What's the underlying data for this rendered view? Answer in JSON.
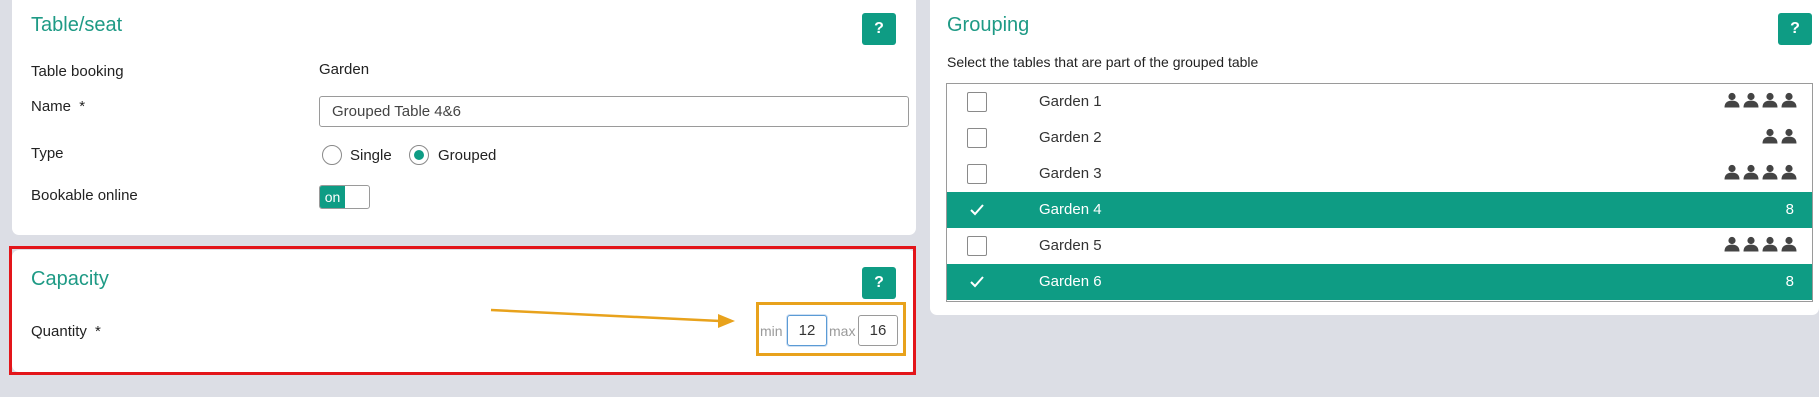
{
  "table_seat_card": {
    "title": "Table/seat",
    "help_label": "?",
    "table_booking_label": "Table booking",
    "table_booking_value": "Garden",
    "name_label": "Name",
    "required_marker": "*",
    "name_value": "Grouped Table 4&6",
    "type_label": "Type",
    "type_options": [
      "Single",
      "Grouped"
    ],
    "type_selected": "Grouped",
    "bookable_label": "Bookable online",
    "bookable_toggle": "on"
  },
  "capacity_card": {
    "title": "Capacity",
    "help_label": "?",
    "quantity_label": "Quantity",
    "required_marker": "*",
    "min_label": "min",
    "min_value": "12",
    "max_label": "max",
    "max_value": "16"
  },
  "grouping_card": {
    "title": "Grouping",
    "help_label": "?",
    "instruction": "Select the tables that are part of the grouped table",
    "tables": [
      {
        "name": "Garden 1",
        "selected": false,
        "capacity_icons": 4,
        "count": ""
      },
      {
        "name": "Garden 2",
        "selected": false,
        "capacity_icons": 2,
        "count": ""
      },
      {
        "name": "Garden 3",
        "selected": false,
        "capacity_icons": 4,
        "count": ""
      },
      {
        "name": "Garden 4",
        "selected": true,
        "capacity_icons": 0,
        "count": "8"
      },
      {
        "name": "Garden 5",
        "selected": false,
        "capacity_icons": 4,
        "count": ""
      },
      {
        "name": "Garden 6",
        "selected": true,
        "capacity_icons": 0,
        "count": "8"
      }
    ]
  },
  "colors": {
    "accent": "#0e9c84",
    "title": "#1e9a85",
    "highlight_red": "#e3151a",
    "highlight_yellow": "#e8a21c",
    "annotation_arrow": "#e8a21c"
  }
}
